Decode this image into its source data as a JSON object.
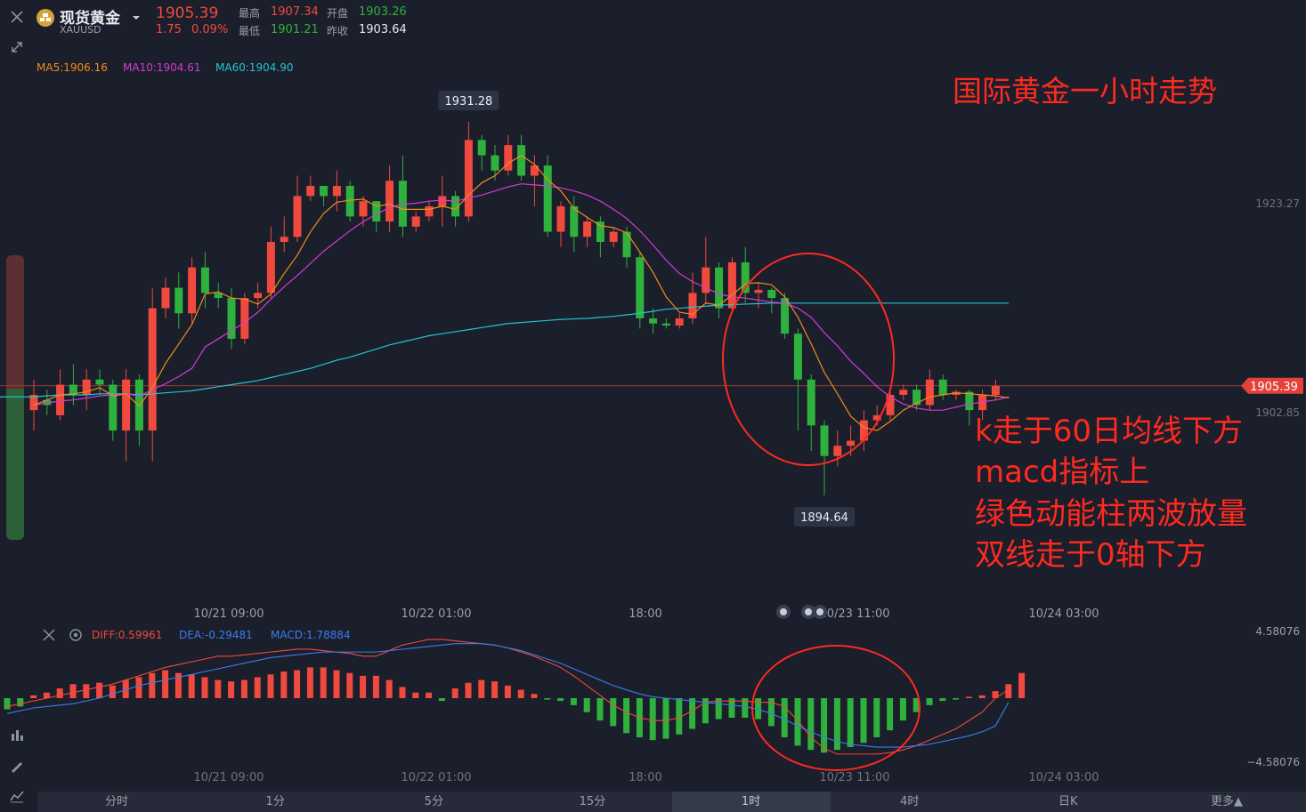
{
  "header": {
    "instrument_name": "现货黄金",
    "symbol": "XAUUSD",
    "price": "1905.39",
    "change": "1.75",
    "change_pct": "0.09%",
    "high_label": "最高",
    "high_value": "1907.34",
    "low_label": "最低",
    "low_value": "1901.21",
    "open_label": "开盘",
    "open_value": "1903.26",
    "prev_close_label": "昨收",
    "prev_close_value": "1903.64"
  },
  "ma_labels": {
    "ma5": "MA5:1906.16",
    "ma10": "MA10:1904.61",
    "ma60": "MA60:1904.90"
  },
  "macd_labels": {
    "diff": "DIFF:0.59961",
    "dea": "DEA:-0.29481",
    "macd": "MACD:1.78884"
  },
  "annotations": {
    "title": "国际黄金一小时走势",
    "line1": "k走于60日均线下方",
    "line2": "macd指标上",
    "line3": "绿色动能柱两波放量",
    "line4": "双线走于0轴下方"
  },
  "colors": {
    "up": "#f04a3e",
    "down": "#2fb13e",
    "ma5": "#f08c1e",
    "ma10": "#d43ad6",
    "ma60": "#26c3d0",
    "diff": "#f04a3e",
    "dea": "#3b7df0",
    "annotation": "#ff2a1f"
  },
  "chart_data": [
    {
      "type": "candlestick",
      "title": "",
      "x_ticks": [
        "10/21 09:00",
        "10/22 01:00",
        "18:00",
        "10/23 11:00",
        "10/24 03:00"
      ],
      "y_tick_labels": [
        "1923.27",
        "1902.85"
      ],
      "current_price_label": "1905.39",
      "high_marker": "1931.28",
      "low_marker": "1894.64",
      "candles": [
        {
          "o": 1903.0,
          "c": 1904.5,
          "h": 1906.0,
          "l": 1901.0
        },
        {
          "o": 1904.0,
          "c": 1903.5,
          "h": 1905.0,
          "l": 1902.5
        },
        {
          "o": 1902.5,
          "c": 1905.5,
          "h": 1907.0,
          "l": 1902.0
        },
        {
          "o": 1905.5,
          "c": 1904.5,
          "h": 1907.5,
          "l": 1903.5
        },
        {
          "o": 1904.5,
          "c": 1906.0,
          "h": 1907.0,
          "l": 1903.0
        },
        {
          "o": 1906.0,
          "c": 1905.5,
          "h": 1907.0,
          "l": 1904.5
        },
        {
          "o": 1905.5,
          "c": 1901.0,
          "h": 1906.0,
          "l": 1900.0
        },
        {
          "o": 1901.0,
          "c": 1906.0,
          "h": 1907.0,
          "l": 1898.0
        },
        {
          "o": 1906.0,
          "c": 1901.0,
          "h": 1906.5,
          "l": 1899.5
        },
        {
          "o": 1901.0,
          "c": 1913.0,
          "h": 1915.0,
          "l": 1898.0
        },
        {
          "o": 1913.0,
          "c": 1915.0,
          "h": 1916.0,
          "l": 1912.0
        },
        {
          "o": 1915.0,
          "c": 1912.5,
          "h": 1916.5,
          "l": 1911.0
        },
        {
          "o": 1912.5,
          "c": 1917.0,
          "h": 1918.0,
          "l": 1911.5
        },
        {
          "o": 1917.0,
          "c": 1914.5,
          "h": 1918.5,
          "l": 1913.0
        },
        {
          "o": 1914.5,
          "c": 1914.0,
          "h": 1915.5,
          "l": 1913.0
        },
        {
          "o": 1914.0,
          "c": 1910.0,
          "h": 1915.0,
          "l": 1909.0
        },
        {
          "o": 1910.0,
          "c": 1914.0,
          "h": 1914.5,
          "l": 1909.5
        },
        {
          "o": 1914.0,
          "c": 1914.5,
          "h": 1915.5,
          "l": 1913.0
        },
        {
          "o": 1914.5,
          "c": 1919.5,
          "h": 1921.0,
          "l": 1914.0
        },
        {
          "o": 1919.5,
          "c": 1920.0,
          "h": 1922.0,
          "l": 1918.5
        },
        {
          "o": 1920.0,
          "c": 1924.0,
          "h": 1926.0,
          "l": 1919.5
        },
        {
          "o": 1924.0,
          "c": 1925.0,
          "h": 1926.0,
          "l": 1923.5
        },
        {
          "o": 1925.0,
          "c": 1924.0,
          "h": 1925.0,
          "l": 1923.0
        },
        {
          "o": 1924.0,
          "c": 1925.0,
          "h": 1926.5,
          "l": 1922.5
        },
        {
          "o": 1925.0,
          "c": 1922.0,
          "h": 1925.5,
          "l": 1921.5
        },
        {
          "o": 1922.0,
          "c": 1923.5,
          "h": 1924.0,
          "l": 1921.0
        },
        {
          "o": 1923.5,
          "c": 1921.5,
          "h": 1923.5,
          "l": 1920.5
        },
        {
          "o": 1921.5,
          "c": 1925.5,
          "h": 1927.0,
          "l": 1920.5
        },
        {
          "o": 1925.5,
          "c": 1921.0,
          "h": 1928.0,
          "l": 1920.0
        },
        {
          "o": 1921.0,
          "c": 1922.0,
          "h": 1922.5,
          "l": 1920.5
        },
        {
          "o": 1922.0,
          "c": 1923.0,
          "h": 1923.5,
          "l": 1921.5
        },
        {
          "o": 1923.0,
          "c": 1924.0,
          "h": 1926.0,
          "l": 1921.0
        },
        {
          "o": 1924.0,
          "c": 1922.0,
          "h": 1924.5,
          "l": 1921.0
        },
        {
          "o": 1922.0,
          "c": 1929.5,
          "h": 1931.28,
          "l": 1921.5
        },
        {
          "o": 1929.5,
          "c": 1928.0,
          "h": 1930.0,
          "l": 1926.5
        },
        {
          "o": 1928.0,
          "c": 1926.5,
          "h": 1929.0,
          "l": 1925.5
        },
        {
          "o": 1926.5,
          "c": 1929.0,
          "h": 1930.0,
          "l": 1926.0
        },
        {
          "o": 1929.0,
          "c": 1926.0,
          "h": 1930.0,
          "l": 1925.5
        },
        {
          "o": 1926.0,
          "c": 1927.0,
          "h": 1928.0,
          "l": 1923.0
        },
        {
          "o": 1927.0,
          "c": 1920.5,
          "h": 1928.0,
          "l": 1920.0
        },
        {
          "o": 1920.5,
          "c": 1923.0,
          "h": 1923.5,
          "l": 1919.0
        },
        {
          "o": 1923.0,
          "c": 1920.0,
          "h": 1924.0,
          "l": 1918.5
        },
        {
          "o": 1920.0,
          "c": 1921.5,
          "h": 1922.0,
          "l": 1919.0
        },
        {
          "o": 1921.5,
          "c": 1919.5,
          "h": 1922.0,
          "l": 1918.0
        },
        {
          "o": 1919.5,
          "c": 1920.5,
          "h": 1921.0,
          "l": 1919.0
        },
        {
          "o": 1920.5,
          "c": 1918.0,
          "h": 1921.0,
          "l": 1917.0
        },
        {
          "o": 1918.0,
          "c": 1912.0,
          "h": 1918.5,
          "l": 1911.0
        },
        {
          "o": 1912.0,
          "c": 1911.5,
          "h": 1913.0,
          "l": 1910.5
        },
        {
          "o": 1911.5,
          "c": 1911.3,
          "h": 1912.0,
          "l": 1911.0
        },
        {
          "o": 1911.3,
          "c": 1912.0,
          "h": 1912.5,
          "l": 1911.0
        },
        {
          "o": 1912.0,
          "c": 1914.5,
          "h": 1916.5,
          "l": 1911.5
        },
        {
          "o": 1914.5,
          "c": 1917.0,
          "h": 1920.0,
          "l": 1913.5
        },
        {
          "o": 1917.0,
          "c": 1913.0,
          "h": 1917.5,
          "l": 1912.0
        },
        {
          "o": 1913.0,
          "c": 1917.5,
          "h": 1918.0,
          "l": 1912.5
        },
        {
          "o": 1917.5,
          "c": 1914.5,
          "h": 1919.0,
          "l": 1913.5
        },
        {
          "o": 1914.5,
          "c": 1914.8,
          "h": 1915.5,
          "l": 1913.0
        },
        {
          "o": 1914.8,
          "c": 1914.0,
          "h": 1915.0,
          "l": 1912.5
        },
        {
          "o": 1914.0,
          "c": 1910.5,
          "h": 1914.5,
          "l": 1910.0
        },
        {
          "o": 1910.5,
          "c": 1906.0,
          "h": 1911.0,
          "l": 1901.0
        },
        {
          "o": 1906.0,
          "c": 1901.5,
          "h": 1906.5,
          "l": 1899.0
        },
        {
          "o": 1901.5,
          "c": 1898.5,
          "h": 1902.0,
          "l": 1894.64
        },
        {
          "o": 1898.5,
          "c": 1899.5,
          "h": 1901.0,
          "l": 1897.5
        },
        {
          "o": 1899.5,
          "c": 1900.0,
          "h": 1901.5,
          "l": 1898.5
        },
        {
          "o": 1900.0,
          "c": 1902.0,
          "h": 1903.0,
          "l": 1899.0
        },
        {
          "o": 1902.0,
          "c": 1902.5,
          "h": 1903.5,
          "l": 1901.5
        },
        {
          "o": 1902.5,
          "c": 1904.5,
          "h": 1905.0,
          "l": 1902.0
        },
        {
          "o": 1904.5,
          "c": 1905.0,
          "h": 1905.5,
          "l": 1904.0
        },
        {
          "o": 1905.0,
          "c": 1903.5,
          "h": 1905.5,
          "l": 1903.0
        },
        {
          "o": 1903.5,
          "c": 1906.0,
          "h": 1907.0,
          "l": 1903.0
        },
        {
          "o": 1906.0,
          "c": 1904.5,
          "h": 1906.5,
          "l": 1904.0
        },
        {
          "o": 1904.5,
          "c": 1904.8,
          "h": 1905.0,
          "l": 1904.0
        },
        {
          "o": 1904.8,
          "c": 1903.0,
          "h": 1905.0,
          "l": 1901.5
        },
        {
          "o": 1903.0,
          "c": 1904.5,
          "h": 1905.0,
          "l": 1902.0
        },
        {
          "o": 1904.5,
          "c": 1905.39,
          "h": 1906.0,
          "l": 1904.0
        }
      ],
      "ma5": [
        1903.5,
        1904.0,
        1904.5,
        1904.6,
        1904.8,
        1905.2,
        1904.4,
        1904.6,
        1903.4,
        1905.2,
        1907.6,
        1909.5,
        1911.4,
        1914.4,
        1914.6,
        1914.0,
        1913.9,
        1913.4,
        1914.4,
        1916.4,
        1918.2,
        1920.5,
        1922.3,
        1923.4,
        1923.6,
        1923.7,
        1923.0,
        1923.2,
        1922.7,
        1922.7,
        1922.7,
        1923.0,
        1922.7,
        1924.1,
        1925.3,
        1926.0,
        1927.2,
        1928.0,
        1927.1,
        1925.6,
        1924.5,
        1922.8,
        1921.9,
        1921.1,
        1920.9,
        1920.4,
        1918.5,
        1916.5,
        1914.1,
        1912.6,
        1912.4,
        1913.5,
        1913.3,
        1914.3,
        1915.4,
        1915.5,
        1915.3,
        1914.1,
        1912.1,
        1909.5,
        1906.7,
        1904.6,
        1902.4,
        1901.3,
        1901.0,
        1901.9,
        1903.0,
        1903.7,
        1904.3,
        1904.5,
        1904.7,
        1904.6,
        1904.5,
        1904.4,
        1904.2
      ],
      "ma10": [
        1903.5,
        1903.7,
        1903.9,
        1904.0,
        1904.2,
        1904.4,
        1904.5,
        1904.6,
        1904.4,
        1905.0,
        1905.6,
        1906.3,
        1907.1,
        1909.2,
        1910.0,
        1910.8,
        1911.6,
        1912.6,
        1913.9,
        1915.1,
        1916.2,
        1917.4,
        1918.6,
        1919.6,
        1920.6,
        1921.5,
        1922.2,
        1922.9,
        1923.2,
        1923.3,
        1923.5,
        1923.6,
        1923.5,
        1923.8,
        1924.1,
        1924.5,
        1924.9,
        1925.2,
        1925.1,
        1925.0,
        1924.8,
        1924.5,
        1924.1,
        1923.5,
        1922.7,
        1921.8,
        1920.6,
        1919.2,
        1917.7,
        1916.4,
        1915.6,
        1915.0,
        1914.4,
        1914.1,
        1914.0,
        1913.8,
        1913.6,
        1913.5,
        1913.0,
        1912.1,
        1910.6,
        1909.3,
        1907.8,
        1906.6,
        1905.3,
        1904.3,
        1903.6,
        1903.2,
        1903.0,
        1903.0,
        1903.3,
        1903.6,
        1903.8,
        1904.0,
        1904.3
      ],
      "ma60": [
        1904.3,
        1904.4,
        1904.5,
        1904.5,
        1904.5,
        1904.6,
        1904.6,
        1904.6,
        1904.5,
        1904.6,
        1904.7,
        1904.8,
        1904.9,
        1905.1,
        1905.3,
        1905.5,
        1905.7,
        1905.9,
        1906.2,
        1906.5,
        1906.8,
        1907.1,
        1907.5,
        1907.9,
        1908.2,
        1908.6,
        1909.0,
        1909.4,
        1909.7,
        1910.0,
        1910.3,
        1910.5,
        1910.7,
        1910.9,
        1911.1,
        1911.3,
        1911.5,
        1911.6,
        1911.7,
        1911.8,
        1911.9,
        1911.95,
        1912.0,
        1912.1,
        1912.2,
        1912.35,
        1912.5,
        1912.7,
        1912.9,
        1913.0,
        1913.1,
        1913.2,
        1913.3,
        1913.35,
        1913.4,
        1913.45,
        1913.5,
        1913.5,
        1913.5,
        1913.5,
        1913.5,
        1913.5,
        1913.5,
        1913.5,
        1913.5,
        1913.5,
        1913.5,
        1913.5,
        1913.5,
        1913.5,
        1913.5,
        1913.5,
        1913.5,
        1913.5,
        1913.5
      ]
    },
    {
      "type": "macd",
      "title": "",
      "x_ticks": [
        "10/21 09:00",
        "10/22 01:00",
        "18:00",
        "10/23 11:00",
        "10/24 03:00"
      ],
      "y_tick_labels": [
        "4.58076",
        "−4.58076"
      ],
      "ylim": [
        -4.58076,
        4.58076
      ],
      "histogram": [
        -0.8,
        -0.6,
        0.2,
        0.4,
        0.7,
        1.0,
        1.0,
        1.1,
        0.9,
        1.3,
        1.5,
        1.8,
        2.0,
        1.8,
        1.7,
        1.5,
        1.3,
        1.2,
        1.3,
        1.5,
        1.7,
        1.9,
        2.0,
        2.2,
        2.2,
        2.0,
        1.8,
        1.6,
        1.6,
        1.3,
        0.8,
        0.4,
        0.4,
        -0.2,
        0.7,
        1.1,
        1.3,
        1.2,
        0.9,
        0.6,
        0.3,
        -0.1,
        -0.2,
        -0.5,
        -1.0,
        -1.6,
        -2.0,
        -2.5,
        -2.8,
        -3.0,
        -2.9,
        -2.6,
        -2.2,
        -1.8,
        -1.5,
        -1.4,
        -1.4,
        -1.5,
        -2.0,
        -2.8,
        -3.4,
        -3.7,
        -3.9,
        -3.7,
        -3.5,
        -3.2,
        -2.8,
        -2.3,
        -1.6,
        -1.0,
        -0.5,
        -0.2,
        -0.1,
        0.1,
        0.2,
        0.5,
        1.0,
        1.8
      ],
      "diff": [
        -0.6,
        -0.4,
        -0.2,
        0.0,
        0.2,
        0.4,
        0.6,
        0.8,
        1.0,
        1.3,
        1.6,
        1.9,
        2.2,
        2.4,
        2.6,
        2.8,
        3.0,
        3.0,
        3.1,
        3.2,
        3.3,
        3.4,
        3.5,
        3.5,
        3.4,
        3.3,
        3.2,
        3.0,
        3.0,
        3.4,
        3.8,
        4.0,
        4.2,
        4.2,
        4.1,
        4.0,
        3.9,
        3.8,
        3.6,
        3.3,
        3.0,
        2.6,
        2.2,
        1.6,
        0.9,
        0.2,
        -0.5,
        -1.0,
        -1.4,
        -1.6,
        -1.6,
        -1.4,
        -0.9,
        -0.3,
        -0.2,
        -0.2,
        -0.2,
        -0.3,
        -0.3,
        -0.6,
        -1.6,
        -2.8,
        -3.6,
        -4.0,
        -4.0,
        -4.0,
        -4.0,
        -3.9,
        -3.7,
        -3.4,
        -3.0,
        -2.6,
        -2.2,
        -1.6,
        -1.0,
        0.0,
        0.6
      ],
      "dea": [
        -1.1,
        -0.9,
        -0.7,
        -0.6,
        -0.5,
        -0.4,
        -0.2,
        0.0,
        0.3,
        0.6,
        0.9,
        1.1,
        1.3,
        1.5,
        1.7,
        1.9,
        2.1,
        2.3,
        2.5,
        2.7,
        2.9,
        3.0,
        3.1,
        3.2,
        3.3,
        3.3,
        3.3,
        3.3,
        3.3,
        3.4,
        3.5,
        3.6,
        3.7,
        3.8,
        3.9,
        3.9,
        3.9,
        3.8,
        3.6,
        3.4,
        3.1,
        2.8,
        2.5,
        2.1,
        1.7,
        1.3,
        0.9,
        0.6,
        0.3,
        0.1,
        0.0,
        -0.1,
        -0.2,
        -0.3,
        -0.4,
        -0.5,
        -0.6,
        -0.8,
        -1.1,
        -1.5,
        -2.0,
        -2.4,
        -2.8,
        -3.1,
        -3.3,
        -3.4,
        -3.5,
        -3.5,
        -3.5,
        -3.4,
        -3.3,
        -3.1,
        -2.9,
        -2.7,
        -2.4,
        -2.0,
        -0.3
      ]
    }
  ],
  "indicator_tabs": [
    "分时",
    "1分",
    "5分",
    "15分",
    "1时",
    "4时",
    "日K",
    "更多▲"
  ]
}
